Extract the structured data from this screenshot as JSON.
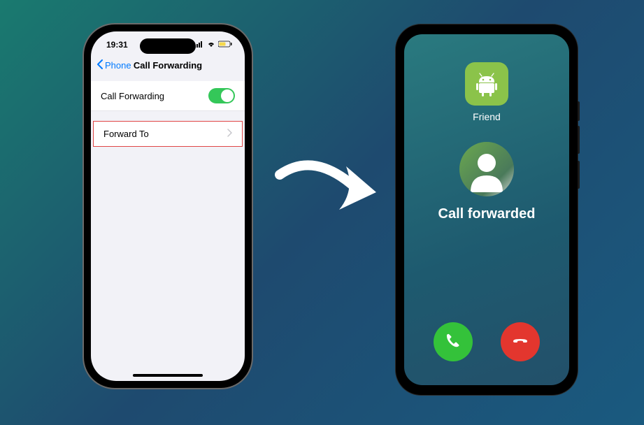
{
  "iphone": {
    "time": "19:31",
    "back_label": "Phone",
    "page_title": "Call Forwarding",
    "row_forwarding_label": "Call Forwarding",
    "toggle_on": true,
    "row_forward_to_label": "Forward To"
  },
  "android": {
    "contact_label": "Friend",
    "status_text": "Call forwarded"
  },
  "icons": {
    "back": "chevron-left-icon",
    "chevron_right": "chevron-right-icon",
    "signal": "signal-icon",
    "wifi": "wifi-icon",
    "battery": "battery-icon",
    "android_logo": "android-icon",
    "contact_avatar": "contact-avatar-icon",
    "phone_accept": "phone-accept-icon",
    "phone_decline": "phone-decline-icon",
    "arrow": "arrow-right-icon"
  },
  "colors": {
    "ios_accent": "#007aff",
    "toggle_green": "#34c759",
    "highlight_red": "#e04646",
    "android_badge": "#8bc34a",
    "accept_green": "#34c23a",
    "decline_red": "#e3362e"
  }
}
